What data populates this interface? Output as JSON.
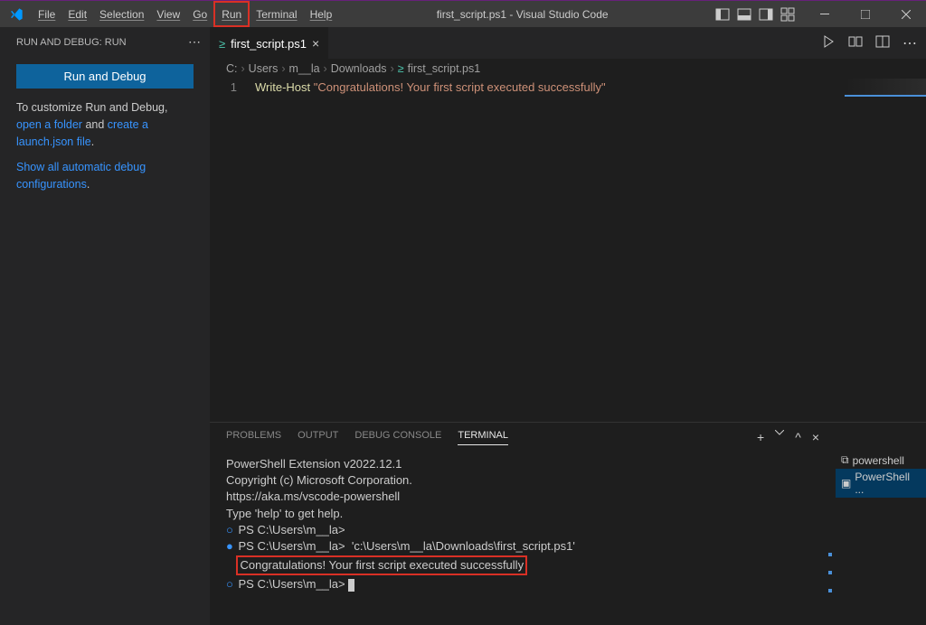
{
  "titlebar": {
    "title": "first_script.ps1 - Visual Studio Code",
    "menu": [
      "File",
      "Edit",
      "Selection",
      "View",
      "Go",
      "Run",
      "Terminal",
      "Help"
    ],
    "highlighted_menu_index": 5
  },
  "sidebar": {
    "header": "RUN AND DEBUG: RUN",
    "button": "Run and Debug",
    "customize_pre": "To customize Run and Debug, ",
    "customize_link1": "open a folder",
    "customize_mid": " and ",
    "customize_link2": "create a launch.json file",
    "customize_post": ".",
    "show_link": "Show all automatic debug configurations",
    "show_post": "."
  },
  "tab": {
    "label": "first_script.ps1"
  },
  "breadcrumbs": [
    "C:",
    "Users",
    "m__la",
    "Downloads",
    "first_script.ps1"
  ],
  "editor": {
    "line_number": "1",
    "cmdlet": "Write-Host",
    "string": "\"Congratulations! Your first script executed successfully\""
  },
  "panel": {
    "tabs": [
      "PROBLEMS",
      "OUTPUT",
      "DEBUG CONSOLE",
      "TERMINAL"
    ],
    "active_tab_index": 3,
    "terminal": {
      "lines": [
        "PowerShell Extension v2022.12.1",
        "Copyright (c) Microsoft Corporation.",
        "",
        "https://aka.ms/vscode-powershell",
        "Type 'help' to get help.",
        ""
      ],
      "prompt1": "PS C:\\Users\\m__la>",
      "cmd_line": "PS C:\\Users\\m__la>  'c:\\Users\\m__la\\Downloads\\first_script.ps1'",
      "output_highlight": "Congratulations! Your first script executed successfully",
      "prompt2": "PS C:\\Users\\m__la> "
    },
    "side": {
      "entries": [
        {
          "icon": "▷",
          "label": "powershell"
        },
        {
          "icon": "▣",
          "label": "PowerShell ..."
        }
      ],
      "active_index": 1
    }
  }
}
